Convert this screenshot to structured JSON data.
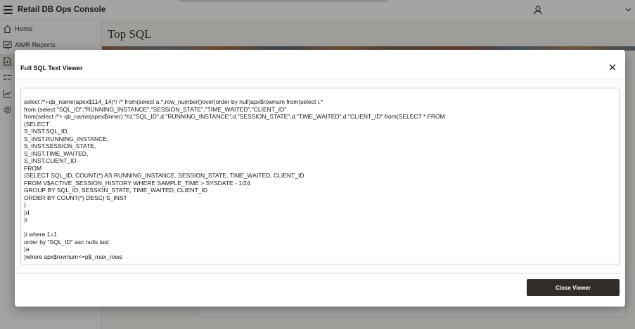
{
  "app": {
    "title": "Retail DB Ops Console"
  },
  "nav": {
    "items": [
      {
        "label": "Home",
        "icon": "home-icon"
      },
      {
        "label": "AWR Reports",
        "icon": "report-icon"
      },
      {
        "label": "",
        "icon": "sql-report-icon"
      },
      {
        "label": "",
        "icon": "checklist-icon"
      },
      {
        "label": "",
        "icon": "line-chart-icon"
      },
      {
        "label": "",
        "icon": "gear-icon"
      }
    ]
  },
  "page": {
    "title": "Top SQL"
  },
  "dialog": {
    "title": "Full SQL Text Viewer",
    "sql_lines": [
      "select /*+qb_name(apex$114_14)*/ /* from(select a.*,row_number()over(order by null)apx$rownum from(select i.*",
      "from (select \"SQL_ID\",\"RUNNING_INSTANCE\",\"SESSION_STATE\",\"TIME_WAITED\",\"CLIENT_ID\"",
      "from(select /*+ qb_name(apex$inner) */d.\"SQL_ID\",d.\"RUNNING_INSTANCE\",d.\"SESSION_STATE\",d.\"TIME_WAITED\",d.\"CLIENT_ID\" from(SELECT * FROM",
      "(SELECT",
      "S_INST.SQL_ID,",
      "S_INST.RUNNING_INSTANCE,",
      "S_INST.SESSION_STATE,",
      "S_INST.TIME_WAITED,",
      "S_INST.CLIENT_ID",
      "FROM",
      "(SELECT SQL_ID, COUNT(*) AS RUNNING_INSTANCE, SESSION_STATE, TIME_WAITED, CLIENT_ID",
      "FROM V$ACTIVE_SESSION_HISTORY WHERE SAMPLE_TIME > SYSDATE - 1/24",
      "GROUP BY SQL_ID, SESSION_STATE, TIME_WAITED, CLIENT_ID",
      "ORDER BY COUNT(*) DESC) S_INST",
      ")",
      ")d",
      ")i",
      "",
      ")i where 1=1",
      "order by \"SQL_ID\" asc nulls last",
      ")a",
      ")where apx$rownum<=p$_max_rows"
    ],
    "close_viewer_label": "Close Viewer"
  }
}
